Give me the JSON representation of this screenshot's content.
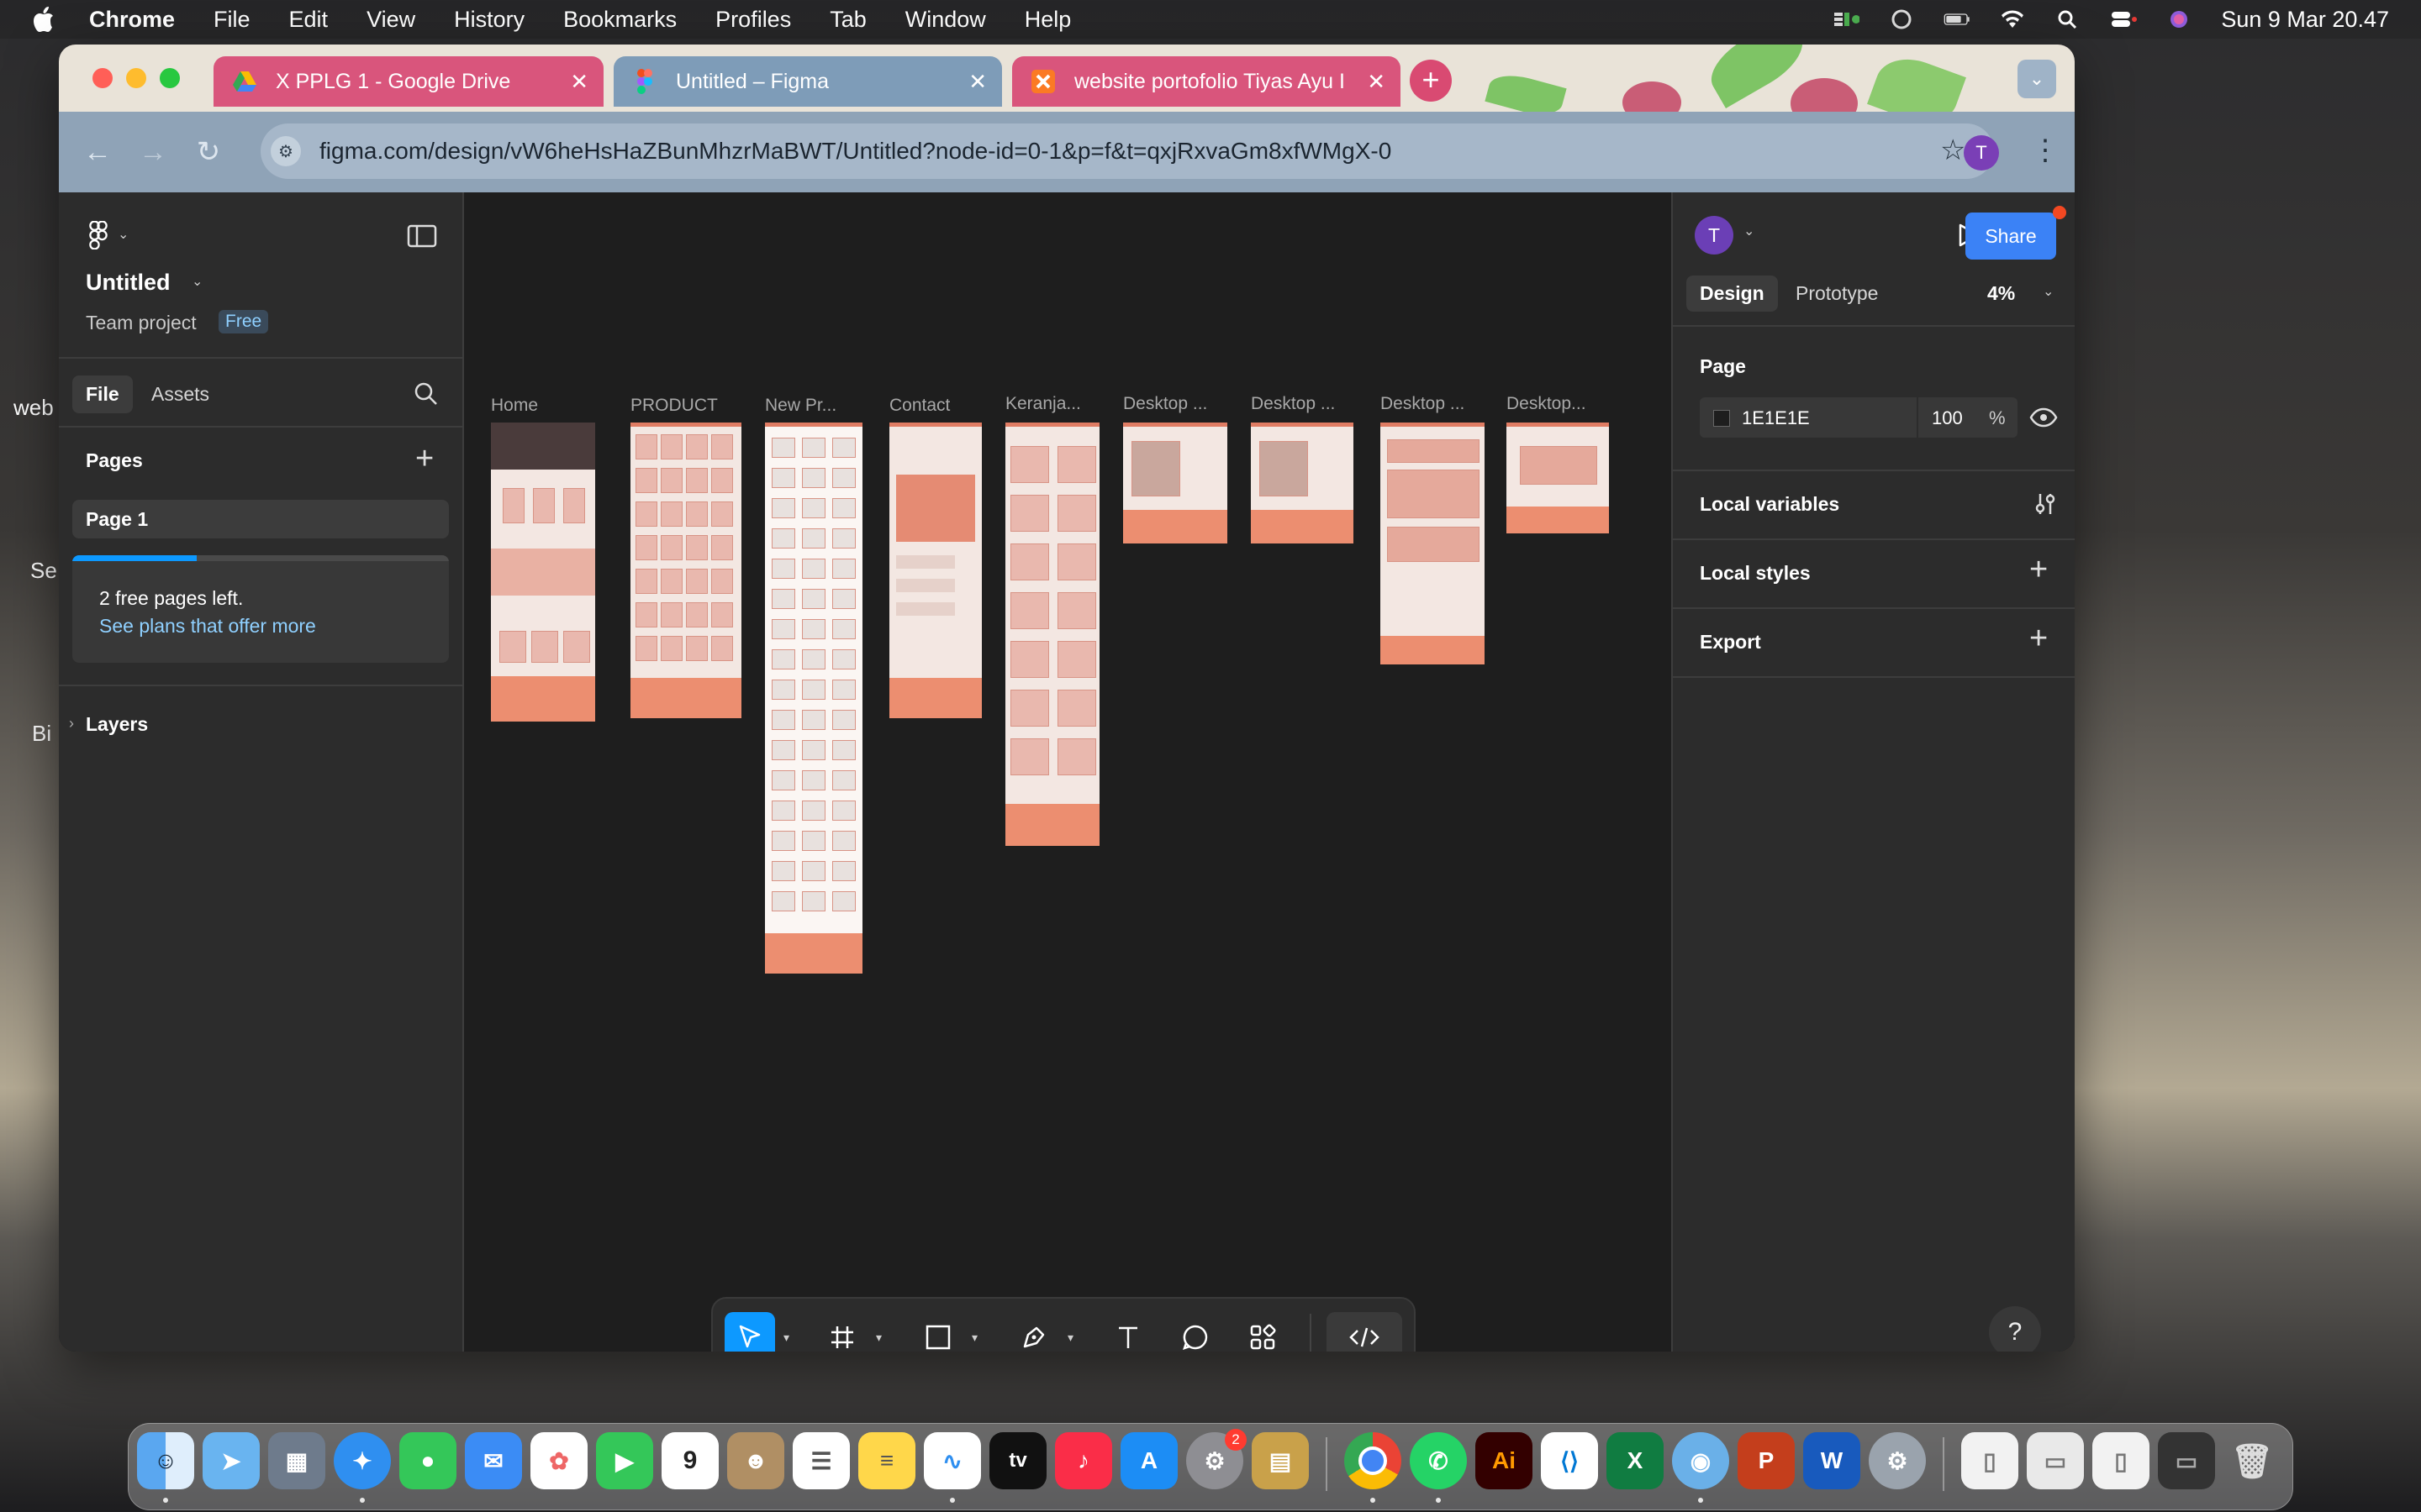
{
  "menubar": {
    "app_name": "Chrome",
    "items": [
      "File",
      "Edit",
      "View",
      "History",
      "Bookmarks",
      "Profiles",
      "Tab",
      "Window",
      "Help"
    ],
    "clock": "Sun 9 Mar  20.47"
  },
  "desktop_hints": [
    "web",
    "Se",
    "Bi"
  ],
  "browser": {
    "tabs": [
      {
        "title": "X PPLG 1 - Google Drive",
        "icon": "google-drive-icon"
      },
      {
        "title": "Untitled – Figma",
        "icon": "figma-icon",
        "active": true
      },
      {
        "title": "website portofolio Tiyas Ayu I",
        "icon": "xampp-icon"
      }
    ],
    "url_host": "figma.com",
    "url_path": "/design/vW6heHsHaZBunMhzrMaBWT/Untitled?node-id=0-1&p=f&t=qxjRxvaGm8xfWMgX-0",
    "profile_initial": "T"
  },
  "figma": {
    "file_title": "Untitled",
    "team_label": "Team project",
    "plan_badge": "Free",
    "left_tabs": {
      "file": "File",
      "assets": "Assets"
    },
    "pages_heading": "Pages",
    "pages": [
      "Page 1"
    ],
    "free_pages_notice": "2 free pages left.",
    "free_pages_progress": 0.33,
    "plans_link": "See plans that offer more",
    "layers_heading": "Layers",
    "canvas_frames": [
      "Home",
      "PRODUCT",
      "New Pr...",
      "Contact",
      "Keranja...",
      "Desktop ...",
      "Desktop ...",
      "Desktop ...",
      "Desktop..."
    ],
    "right": {
      "avatar_initial": "T",
      "share_label": "Share",
      "tab_design": "Design",
      "tab_prototype": "Prototype",
      "zoom": "4%",
      "page_heading": "Page",
      "bg_color_hex": "1E1E1E",
      "bg_opacity": "100",
      "percent_sign": "%",
      "local_variables": "Local variables",
      "local_styles": "Local styles",
      "export": "Export",
      "help_label": "?"
    }
  },
  "colors": {
    "accent_blue": "#0d99ff",
    "share_button": "#3b82f6",
    "frame_footer": "#ec8e70",
    "tab_active": "#7e9cb8",
    "tab_inactive": "#d9557c"
  }
}
